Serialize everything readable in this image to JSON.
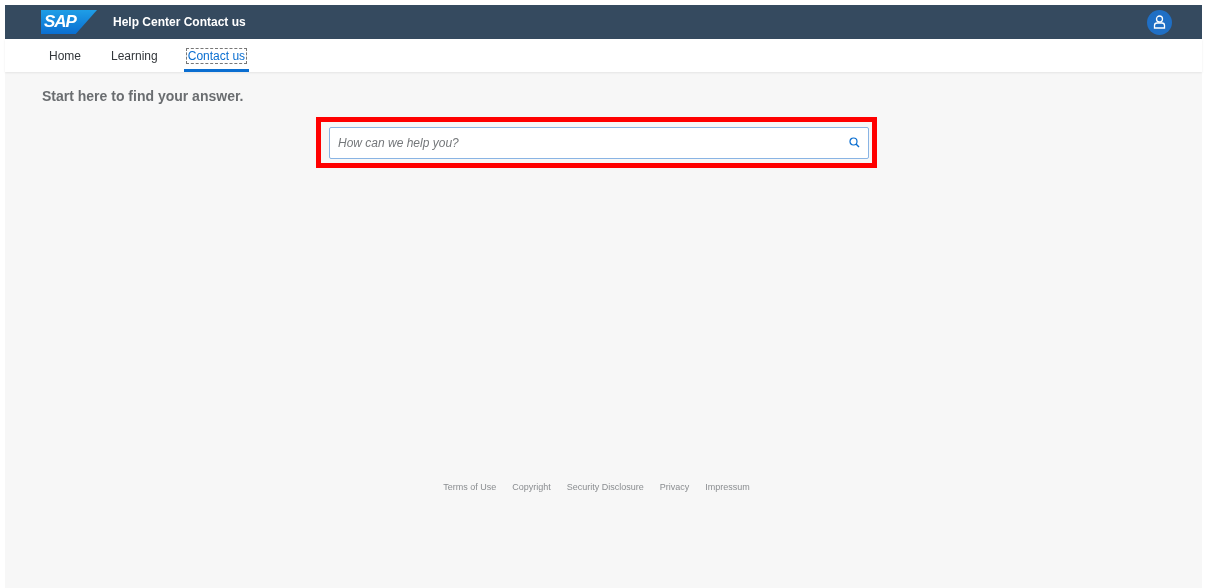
{
  "header": {
    "logo": "SAP",
    "title": "Help Center Contact us"
  },
  "nav": [
    {
      "label": "Home",
      "selected": false
    },
    {
      "label": "Learning",
      "selected": false
    },
    {
      "label": "Contact us",
      "selected": true
    }
  ],
  "heading": "Start here to find your answer.",
  "search": {
    "placeholder": "How can we help you?",
    "highlighted": true
  },
  "footer": [
    "Terms of Use",
    "Copyright",
    "Security Disclosure",
    "Privacy",
    "Impressum"
  ]
}
